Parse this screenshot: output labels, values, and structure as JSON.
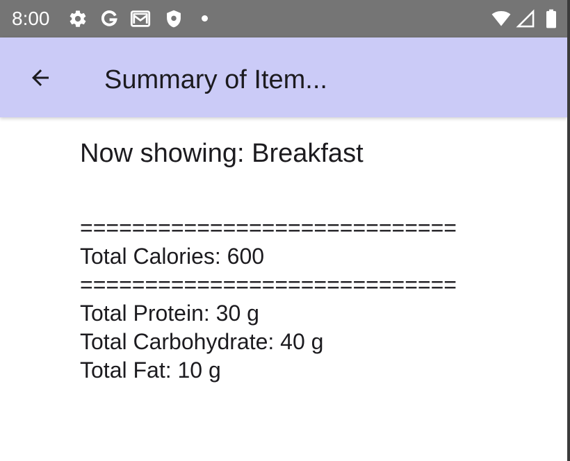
{
  "status_bar": {
    "time": "8:00",
    "icons": [
      "gear-icon",
      "google-g-icon",
      "gmail-icon",
      "shield-icon",
      "notification-dot-icon",
      "wifi-icon",
      "cellular-signal-icon",
      "battery-icon"
    ]
  },
  "app_bar": {
    "back_icon": "arrow-back-icon",
    "title": "Summary of Item...",
    "background_color": "#cbcbf7"
  },
  "content": {
    "now_showing": "Now showing: Breakfast",
    "divider_1": "=============================",
    "total_calories": "Total Calories: 600",
    "divider_2": "=============================",
    "total_protein": "Total Protein: 30 g",
    "total_carbohydrate": "Total Carbohydrate: 40 g",
    "total_fat": "Total Fat: 10 g"
  }
}
